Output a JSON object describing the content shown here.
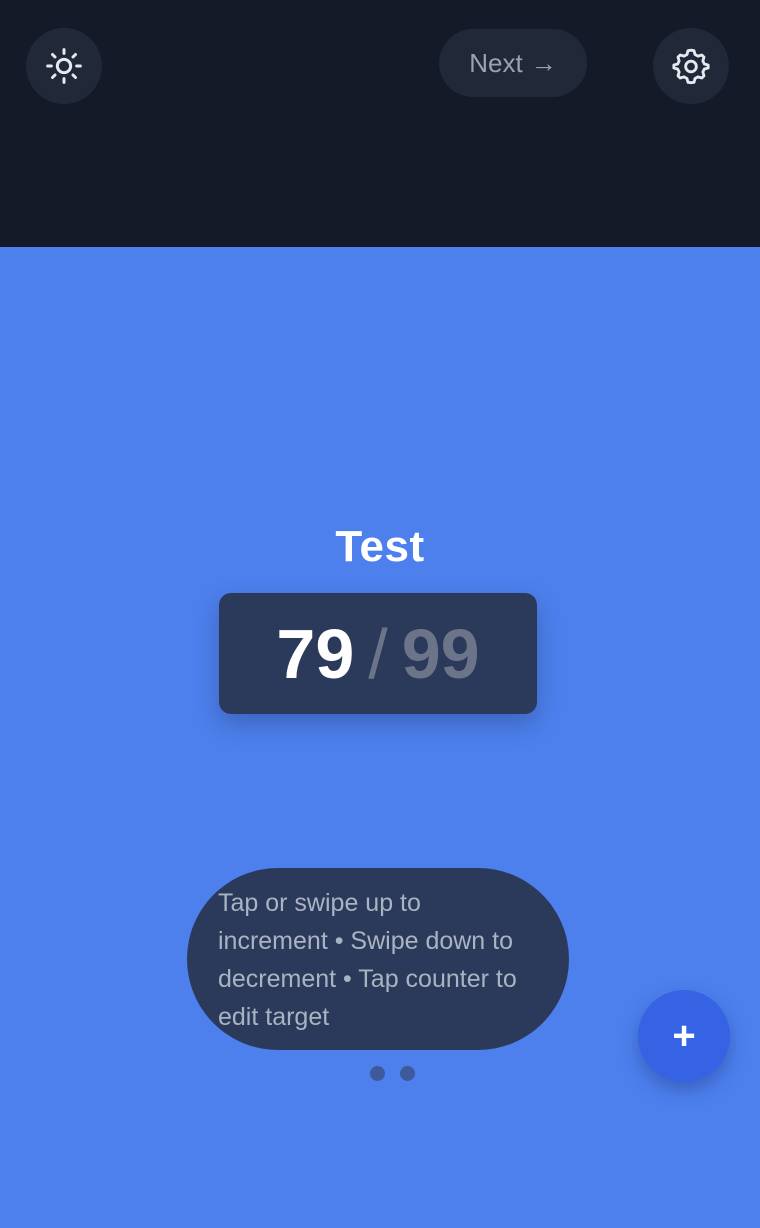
{
  "colors": {
    "topbar_bg": "#141a27",
    "screen_bg": "#4d80ed",
    "panel_bg": "#2b3a5a",
    "fab_bg": "#3663e3"
  },
  "toolbar": {
    "theme_icon": "sun-icon",
    "next_label": "Next",
    "next_icon": "→",
    "settings_icon": "gear-icon"
  },
  "counter": {
    "title": "Test",
    "current": "79",
    "separator": "/",
    "target": "99"
  },
  "hint": {
    "text": "Tap or swipe up to increment • Swipe down to decrement • Tap counter to edit target"
  },
  "pager": {
    "count": 2
  },
  "fab": {
    "label": "+"
  }
}
